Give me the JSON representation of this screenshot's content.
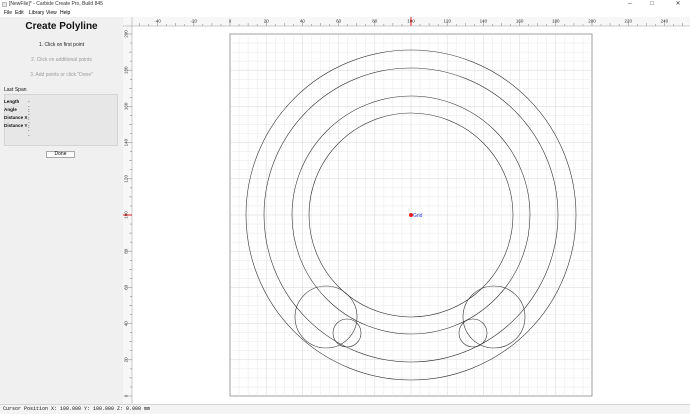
{
  "window": {
    "title": "[NewFile]* - Carbide Create Pro, Build 845",
    "minimize_glyph": "─",
    "maximize_glyph": "□",
    "close_glyph": "✕"
  },
  "menu": {
    "items": [
      "File",
      "Edit",
      "Library",
      "View",
      "Help"
    ]
  },
  "panel": {
    "heading": "Create Polyline",
    "steps": [
      "1. Click on first point",
      "2. Click on additional points",
      "3. Add points or click \"Done\""
    ],
    "last_span": {
      "label": "Last Span",
      "rows": [
        {
          "key": "Length",
          "value": "---"
        },
        {
          "key": "Angle",
          "value": "---"
        },
        {
          "key": "Distance X",
          "value": "---"
        },
        {
          "key": "Distance Y",
          "value": "---"
        }
      ]
    },
    "done_label": "Done"
  },
  "rulers": {
    "top_labels": [
      "-40",
      "-20",
      "0",
      "20",
      "40",
      "60",
      "80",
      "100",
      "120",
      "140",
      "160",
      "180",
      "200",
      "220",
      "240"
    ],
    "left_labels": [
      "200",
      "180",
      "160",
      "140",
      "120",
      "100",
      "80",
      "60",
      "40",
      "20",
      "0"
    ]
  },
  "canvas": {
    "grid_label": "Grid",
    "cursor_marker_color": "#e02020",
    "grid_label_color": "#2a3fd6"
  },
  "status": {
    "cursor_position": "Cursor Position X: 100.000 Y: 100.000 Z: 0.000 mm"
  }
}
